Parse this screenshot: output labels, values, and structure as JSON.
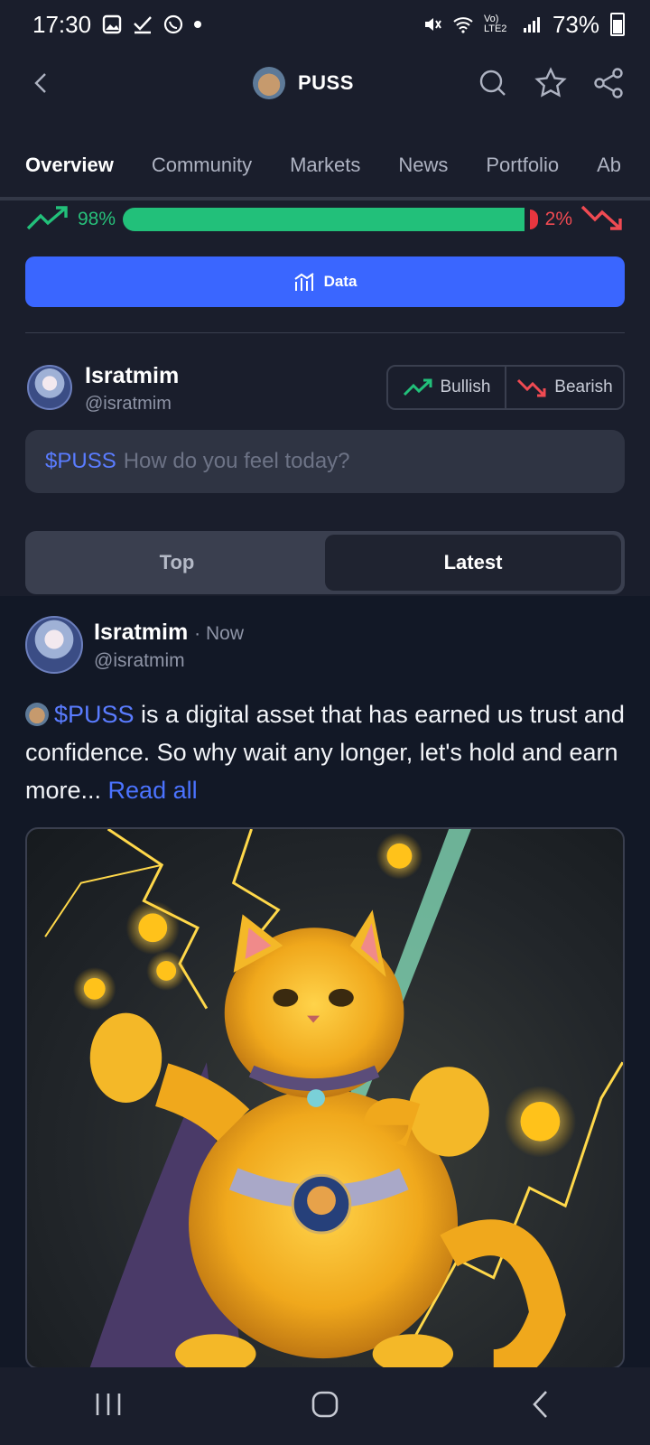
{
  "status_bar": {
    "time": "17:30",
    "network": "Vo) LTE2",
    "battery": "73%"
  },
  "header": {
    "title": "PUSS",
    "icons": [
      "back-icon",
      "search-icon",
      "star-icon",
      "share-icon"
    ]
  },
  "tabs": [
    {
      "label": "Overview",
      "active": true
    },
    {
      "label": "Community",
      "active": false
    },
    {
      "label": "Markets",
      "active": false
    },
    {
      "label": "News",
      "active": false
    },
    {
      "label": "Portfolio",
      "active": false
    },
    {
      "label": "Ab",
      "active": false
    }
  ],
  "sentiment": {
    "bullish_percent": "98%",
    "bearish_percent": "2%",
    "bullish_fraction": 0.98,
    "colors": {
      "bullish": "#22c07a",
      "bearish": "#e9363f"
    }
  },
  "data_button": {
    "label": "Data"
  },
  "composer": {
    "name": "Isratmim",
    "handle": "@isratmim",
    "bullish_label": "Bullish",
    "bearish_label": "Bearish",
    "ticker": "$PUSS",
    "placeholder": "How do you feel today?"
  },
  "feed_toggle": {
    "top_label": "Top",
    "latest_label": "Latest",
    "selected": "Latest"
  },
  "post": {
    "author": "Isratmim",
    "time": "· Now",
    "handle": "@isratmim",
    "cashtag": "$PUSS",
    "body": " is a digital asset that has earned us trust and confidence. So why wait any longer, let's hold and earn more...",
    "read_all": "Read all",
    "image_alt": "golden cat with cape and lightning"
  },
  "accent": "#3a66ff"
}
